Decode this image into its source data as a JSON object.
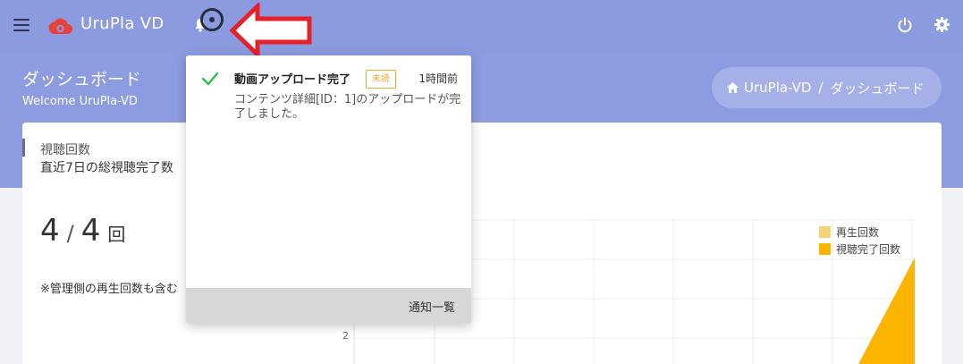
{
  "header": {
    "brand": "UruPla VD",
    "colors": {
      "bar": "#8c9ae0",
      "logo": "#e8413c"
    }
  },
  "page": {
    "title": "ダッシュボード",
    "subtitle": "Welcome UruPla-VD"
  },
  "breadcrumb": {
    "home": "UruPla-VD",
    "separator": "/",
    "current": "ダッシュボード"
  },
  "stat": {
    "label": "視聴回数",
    "description": "直近7日の総視聴完了数",
    "value_completed": "4",
    "slash": "/",
    "value_total": "4",
    "unit": "回",
    "note": "※管理側の再生回数も含む"
  },
  "chart_data": {
    "type": "area",
    "series": [
      {
        "name": "再生回数",
        "color": "#f5d27a"
      },
      {
        "name": "視聴完了回数",
        "color": "#fbb400"
      }
    ],
    "yticks": [
      "2"
    ]
  },
  "notification": {
    "title": "動画アップロード完了",
    "badge": "未読",
    "time": "1時間前",
    "body": "コンテンツ詳細[ID：1]のアップロードが完了しました。",
    "footer": "通知一覧"
  }
}
